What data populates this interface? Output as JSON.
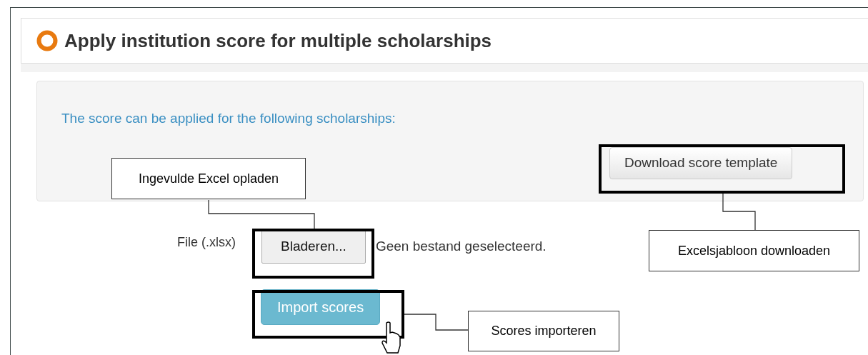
{
  "panel": {
    "title": "Apply institution score for multiple scholarships"
  },
  "info_text": "The score can be applied for the following scholarships:",
  "download_button": "Download score template",
  "file_field": {
    "label": "File (.xlsx)",
    "browse_button": "Bladeren...",
    "status": "Geen bestand geselecteerd."
  },
  "import_button": "Import scores",
  "annotations": [
    {
      "text": "Ingevulde Excel opladen"
    },
    {
      "text": "Excelsjabloon downloaden"
    },
    {
      "text": "Scores importeren"
    }
  ]
}
